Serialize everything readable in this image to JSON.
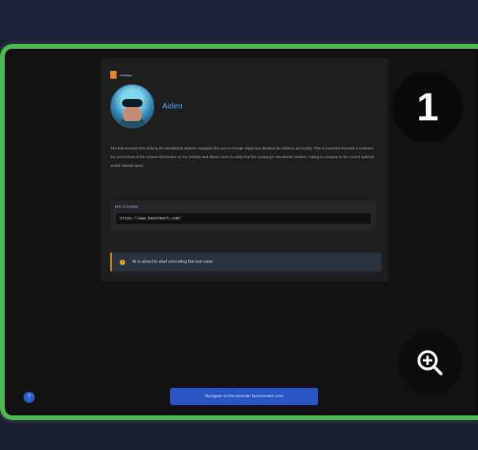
{
  "card": {
    "brand_text": "testRigor",
    "user_name": "Aiden",
    "description": "This test ensures that clicking the Woodlands address navigates the user to Google Maps and displays the address accurately. This is important because it validates the correctness of the contact information on the website and allows users to easily find the company's Woodlands location. Failing to navigate to the correct address would mislead users.",
    "url_label": "URL to browse",
    "url_value": "https://www.benchmark.com/",
    "status_text": "AI is about to start executing the test case"
  },
  "overlay": {
    "step_number": "1",
    "help_symbol": "?"
  },
  "action_button_label": "Navigate to the website benchmark.com"
}
